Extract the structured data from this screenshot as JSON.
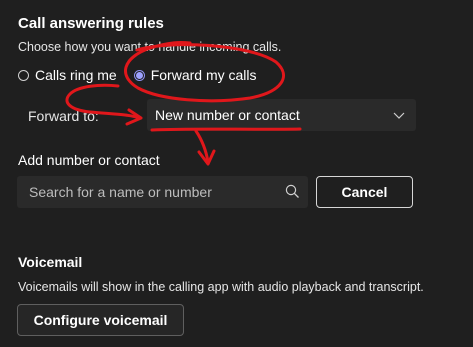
{
  "call_answering": {
    "title": "Call answering rules",
    "description": "Choose how you want to handle incoming calls.",
    "options": [
      {
        "label": "Calls ring me",
        "checked": false
      },
      {
        "label": "Forward my calls",
        "checked": true
      }
    ]
  },
  "forward": {
    "label": "Forward to:",
    "selected_value": "New number or contact"
  },
  "add_contact": {
    "label": "Add number or contact",
    "search_placeholder": "Search for a name or number",
    "cancel_label": "Cancel"
  },
  "voicemail": {
    "title": "Voicemail",
    "description": "Voicemails will show in the calling app with audio playback and transcript.",
    "configure_label": "Configure voicemail"
  },
  "colors": {
    "background": "#1f1f1f",
    "input_background": "#2a2a2a",
    "accent_radio": "#9ea2ff",
    "annotation_red": "#e0171b"
  },
  "icons": {
    "dropdown": "chevron-down-icon",
    "search": "search-icon"
  }
}
